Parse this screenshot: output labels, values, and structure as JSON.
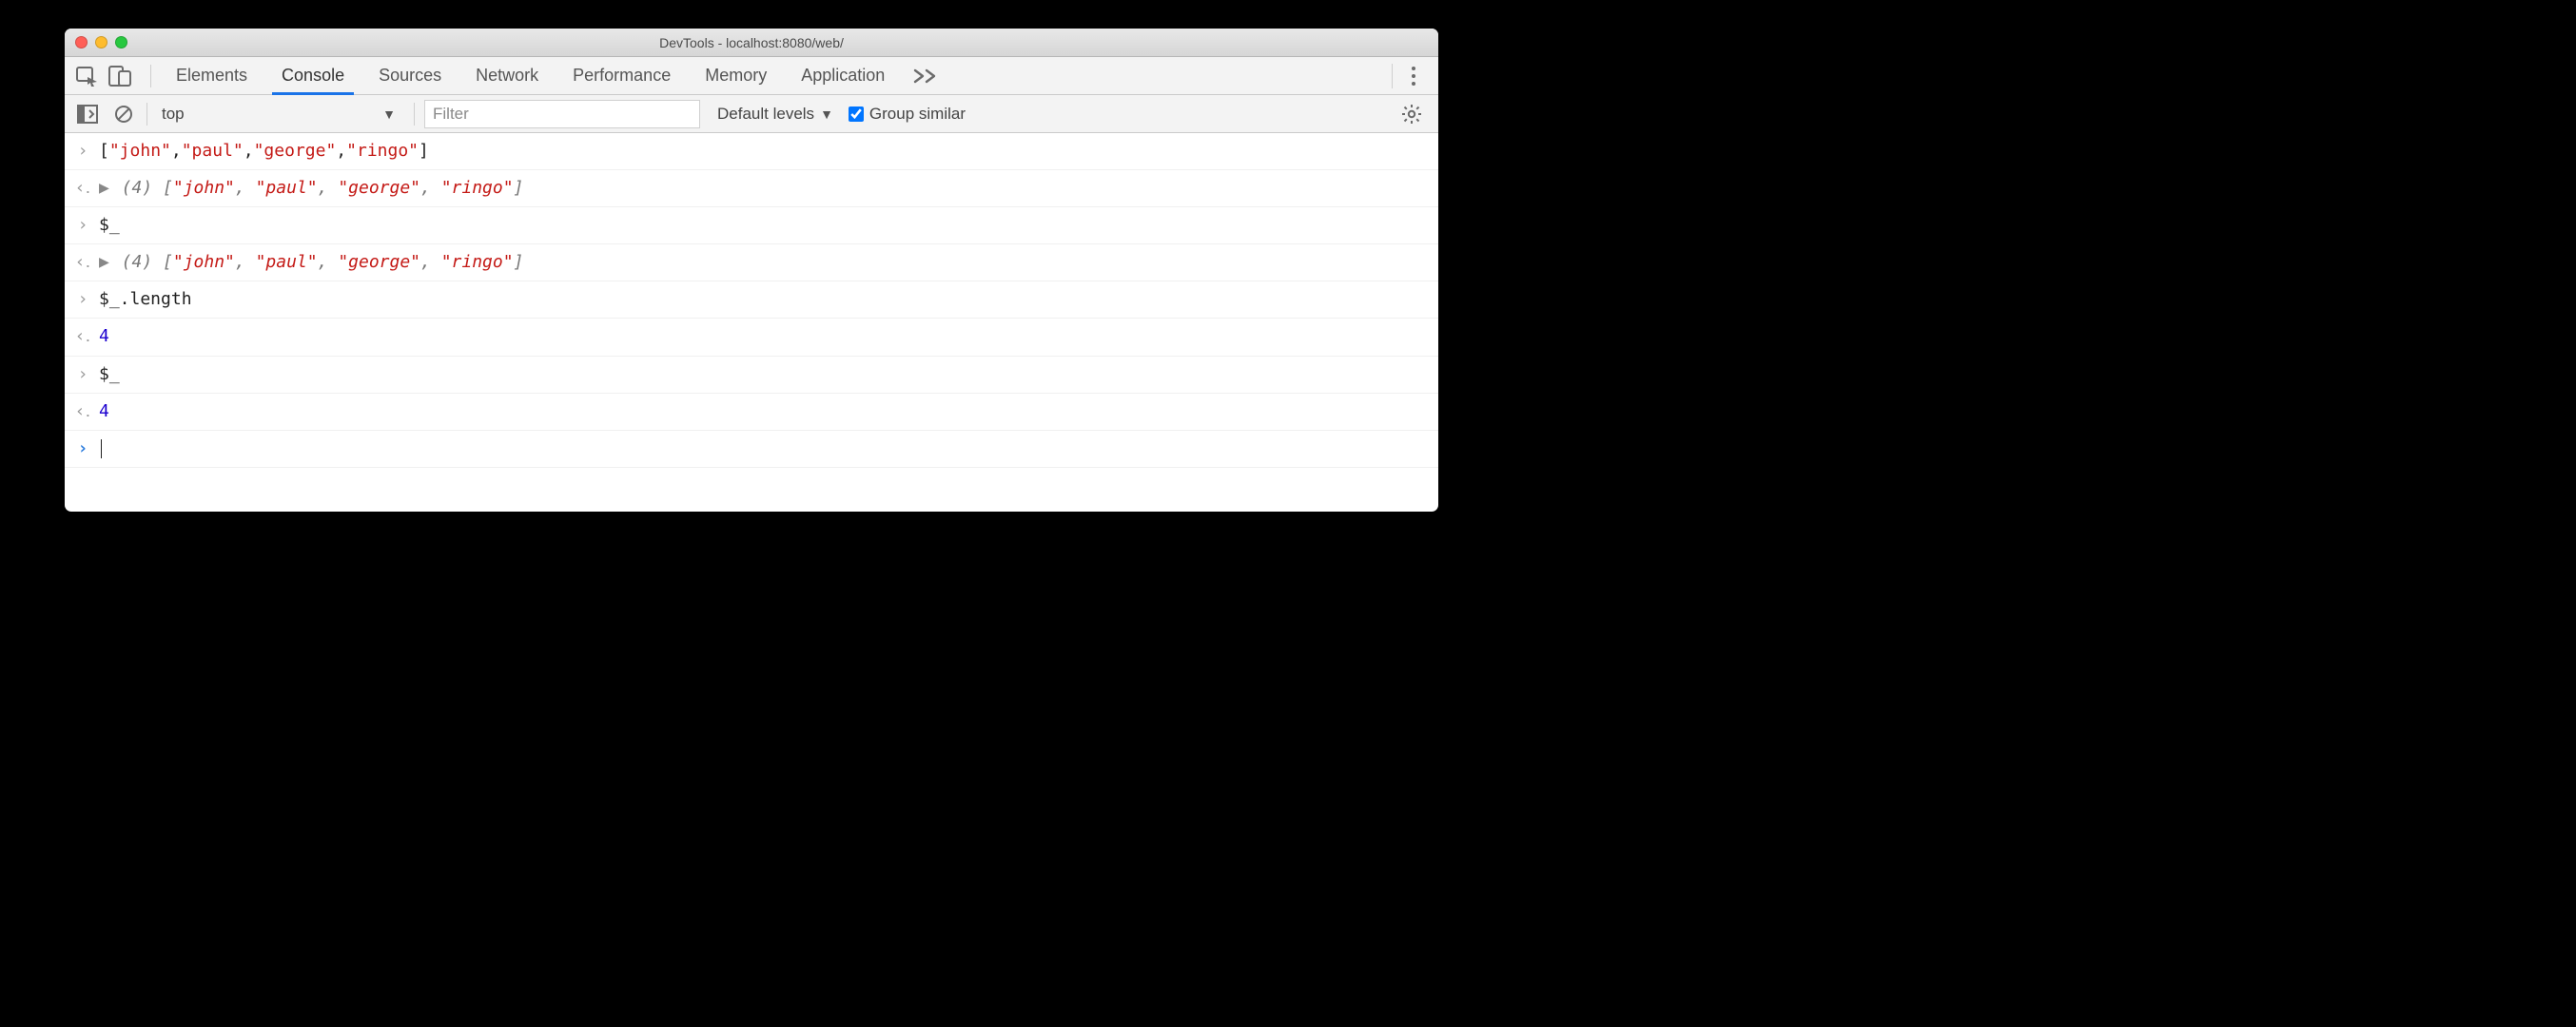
{
  "window": {
    "title": "DevTools - localhost:8080/web/"
  },
  "tabs": {
    "items": [
      "Elements",
      "Console",
      "Sources",
      "Network",
      "Performance",
      "Memory",
      "Application"
    ],
    "active_index": 1
  },
  "toolbar": {
    "context": "top",
    "filter_placeholder": "Filter",
    "levels_label": "Default levels",
    "group_similar_label": "Group similar",
    "group_similar_checked": true
  },
  "console": {
    "entries": [
      {
        "kind": "input",
        "tokens": [
          {
            "t": "[",
            "c": "black"
          },
          {
            "t": "\"john\"",
            "c": "red"
          },
          {
            "t": ",",
            "c": "black"
          },
          {
            "t": "\"paul\"",
            "c": "red"
          },
          {
            "t": ",",
            "c": "black"
          },
          {
            "t": "\"george\"",
            "c": "red"
          },
          {
            "t": ",",
            "c": "black"
          },
          {
            "t": "\"ringo\"",
            "c": "red"
          },
          {
            "t": "]",
            "c": "black"
          }
        ]
      },
      {
        "kind": "result",
        "expandable": true,
        "preview_count": "(4)",
        "tokens": [
          {
            "t": "[",
            "c": "italic"
          },
          {
            "t": "\"john\"",
            "c": "red"
          },
          {
            "t": ", ",
            "c": "italic"
          },
          {
            "t": "\"paul\"",
            "c": "red"
          },
          {
            "t": ", ",
            "c": "italic"
          },
          {
            "t": "\"george\"",
            "c": "red"
          },
          {
            "t": ", ",
            "c": "italic"
          },
          {
            "t": "\"ringo\"",
            "c": "red"
          },
          {
            "t": "]",
            "c": "italic"
          }
        ]
      },
      {
        "kind": "input",
        "tokens": [
          {
            "t": "$_",
            "c": "black"
          }
        ]
      },
      {
        "kind": "result",
        "expandable": true,
        "preview_count": "(4)",
        "tokens": [
          {
            "t": "[",
            "c": "italic"
          },
          {
            "t": "\"john\"",
            "c": "red"
          },
          {
            "t": ", ",
            "c": "italic"
          },
          {
            "t": "\"paul\"",
            "c": "red"
          },
          {
            "t": ", ",
            "c": "italic"
          },
          {
            "t": "\"george\"",
            "c": "red"
          },
          {
            "t": ", ",
            "c": "italic"
          },
          {
            "t": "\"ringo\"",
            "c": "red"
          },
          {
            "t": "]",
            "c": "italic"
          }
        ]
      },
      {
        "kind": "input",
        "tokens": [
          {
            "t": "$_.length",
            "c": "black"
          }
        ]
      },
      {
        "kind": "result",
        "tokens": [
          {
            "t": "4",
            "c": "num"
          }
        ]
      },
      {
        "kind": "input",
        "tokens": [
          {
            "t": "$_",
            "c": "black"
          }
        ]
      },
      {
        "kind": "result",
        "tokens": [
          {
            "t": "4",
            "c": "num"
          }
        ]
      },
      {
        "kind": "prompt"
      }
    ]
  }
}
